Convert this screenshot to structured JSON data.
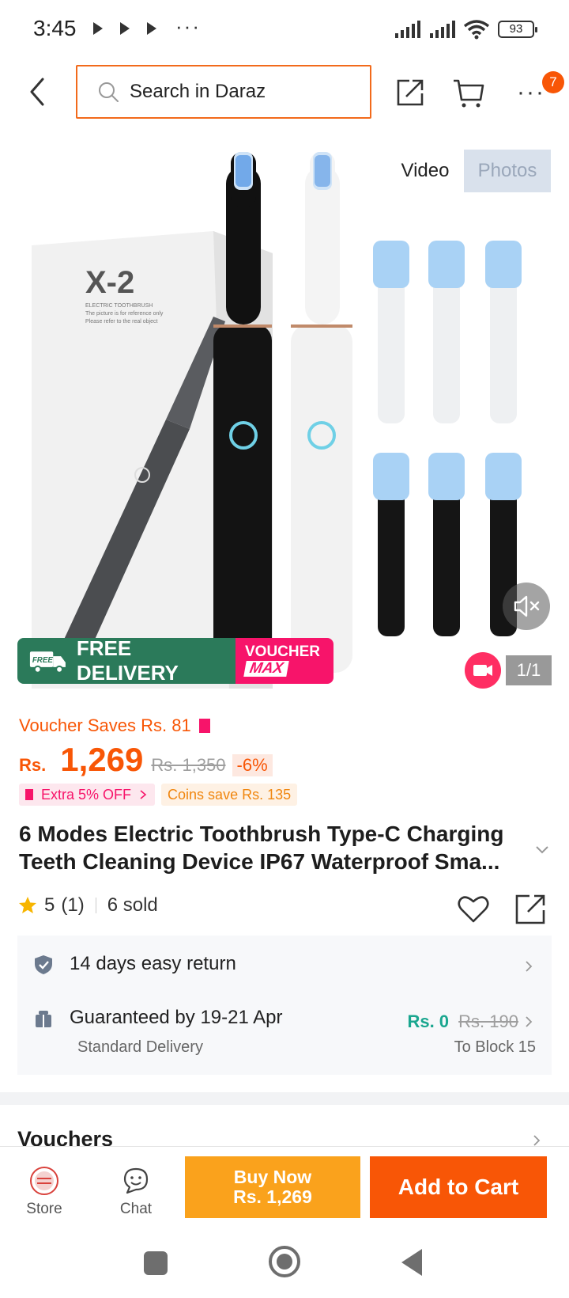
{
  "status_bar": {
    "time": "3:45",
    "battery": "93"
  },
  "header": {
    "search_placeholder": "Search in Daraz",
    "cart_badge": "7"
  },
  "gallery": {
    "tabs": [
      "Video",
      "Photos"
    ],
    "active_tab": "Video",
    "counter": "1/1",
    "product_text": {
      "model": "X-2",
      "line1": "ELECTRIC TOOTHBRUSH",
      "line2": "The picture is for reference only",
      "line3": "Please refer to the real object"
    },
    "banner": {
      "free_delivery": "FREE DELIVERY",
      "truck_label": "FREE",
      "voucher": "VOUCHER",
      "voucher_max": "MAX"
    }
  },
  "price": {
    "voucher_saves": "Voucher Saves Rs. 81",
    "currency": "Rs.",
    "amount": "1,269",
    "original": "Rs. 1,350",
    "discount": "-6%",
    "extra_off": "Extra 5% OFF",
    "coins": "Coins save Rs. 135"
  },
  "product": {
    "title": "6 Modes Electric Toothbrush Type-C Charging Teeth Cleaning Device IP67 Waterproof Sma...",
    "rating": "5",
    "rating_count": "(1)",
    "sold": "6 sold",
    "rating_value": 5
  },
  "service": {
    "returns": "14 days easy return",
    "guarantee": "Guaranteed by 19-21 Apr",
    "delivery_type": "Standard Delivery",
    "delivery_price": "Rs. 0",
    "delivery_old_price": "Rs. 190",
    "destination": "To Block 15"
  },
  "vouchers_title": "Vouchers",
  "bottom_bar": {
    "store": "Store",
    "chat": "Chat",
    "buy_now": "Buy Now",
    "buy_now_price": "Rs. 1,269",
    "add_to_cart": "Add to Cart"
  },
  "colors": {
    "accent": "#f85606",
    "buy_now": "#faa21c",
    "voucher_pink": "#f7146a",
    "free_delivery_green": "#2b7a5a",
    "delivery_price": "#1aa68f"
  }
}
